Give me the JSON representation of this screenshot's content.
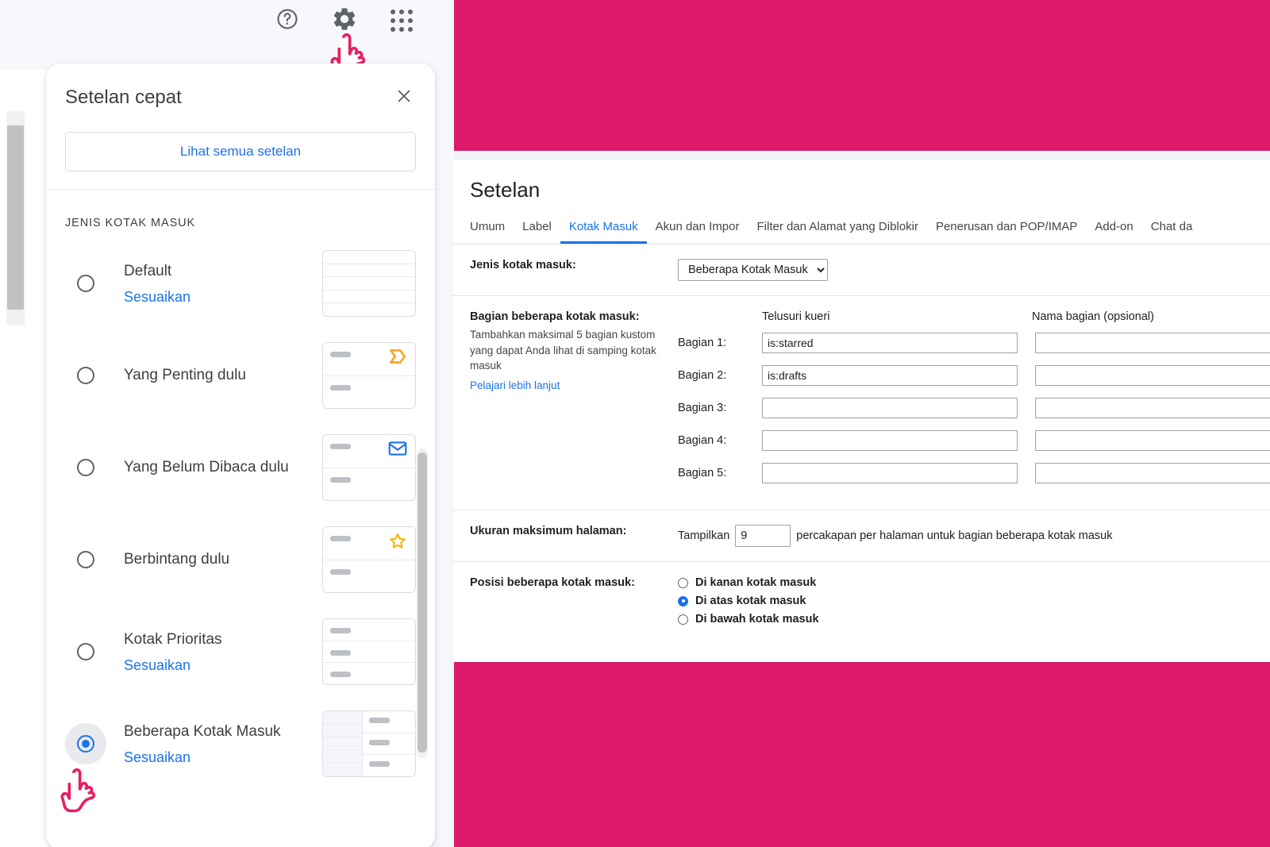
{
  "colors": {
    "backdrop_magenta": "#dd1a6a",
    "accent_blue": "#1a73e8",
    "cursor_pink": "#e91e63",
    "important_orange": "#f5a623",
    "star_yellow": "#f4b400"
  },
  "topbar": {
    "help_icon": "help-circle-icon",
    "settings_icon": "gear-icon",
    "apps_icon": "apps-grid-icon"
  },
  "quick_settings": {
    "title": "Setelan cepat",
    "close_icon": "close-icon",
    "see_all_label": "Lihat semua setelan",
    "section_label": "JENIS KOTAK MASUK",
    "items": [
      {
        "label": "Default",
        "customize": "Sesuaikan",
        "selected": false,
        "thumb": "plain-lines"
      },
      {
        "label": "Yang Penting dulu",
        "customize": null,
        "selected": false,
        "thumb": "important-marker"
      },
      {
        "label": "Yang Belum Dibaca dulu",
        "customize": null,
        "selected": false,
        "thumb": "unread-envelope"
      },
      {
        "label": "Berbintang dulu",
        "customize": null,
        "selected": false,
        "thumb": "starred"
      },
      {
        "label": "Kotak Prioritas",
        "customize": "Sesuaikan",
        "selected": false,
        "thumb": "priority-three-rows"
      },
      {
        "label": "Beberapa Kotak Masuk",
        "customize": "Sesuaikan",
        "selected": true,
        "thumb": "multiple-inboxes"
      }
    ]
  },
  "settings_window": {
    "title": "Setelan",
    "tabs": [
      {
        "label": "Umum",
        "active": false
      },
      {
        "label": "Label",
        "active": false
      },
      {
        "label": "Kotak Masuk",
        "active": true
      },
      {
        "label": "Akun dan Impor",
        "active": false
      },
      {
        "label": "Filter dan Alamat yang Diblokir",
        "active": false
      },
      {
        "label": "Penerusan dan POP/IMAP",
        "active": false
      },
      {
        "label": "Add-on",
        "active": false
      },
      {
        "label": "Chat da",
        "active": false
      }
    ],
    "inbox_type": {
      "label": "Jenis kotak masuk:",
      "selected_value": "Beberapa Kotak Masuk",
      "options": [
        "Default",
        "Yang Penting dulu",
        "Yang Belum Dibaca dulu",
        "Berbintang dulu",
        "Kotak Prioritas",
        "Beberapa Kotak Masuk"
      ]
    },
    "sections": {
      "label": "Bagian beberapa kotak masuk:",
      "description": "Tambahkan maksimal 5 bagian kustom yang dapat Anda lihat di samping kotak masuk",
      "learn_more": "Pelajari lebih lanjut",
      "col_query": "Telusuri kueri",
      "col_name": "Nama bagian (opsional)",
      "rows": [
        {
          "label": "Bagian 1:",
          "query": "is:starred",
          "name": ""
        },
        {
          "label": "Bagian 2:",
          "query": "is:drafts",
          "name": ""
        },
        {
          "label": "Bagian 3:",
          "query": "",
          "name": ""
        },
        {
          "label": "Bagian 4:",
          "query": "",
          "name": ""
        },
        {
          "label": "Bagian 5:",
          "query": "",
          "name": ""
        }
      ]
    },
    "page_size": {
      "label": "Ukuran maksimum halaman:",
      "prefix": "Tampilkan",
      "value": "9",
      "suffix": "percakapan per halaman untuk bagian beberapa kotak masuk"
    },
    "position": {
      "label": "Posisi beberapa kotak masuk:",
      "options": [
        {
          "label": "Di kanan kotak masuk",
          "selected": false
        },
        {
          "label": "Di atas kotak masuk",
          "selected": true
        },
        {
          "label": "Di bawah kotak masuk",
          "selected": false
        }
      ]
    }
  }
}
